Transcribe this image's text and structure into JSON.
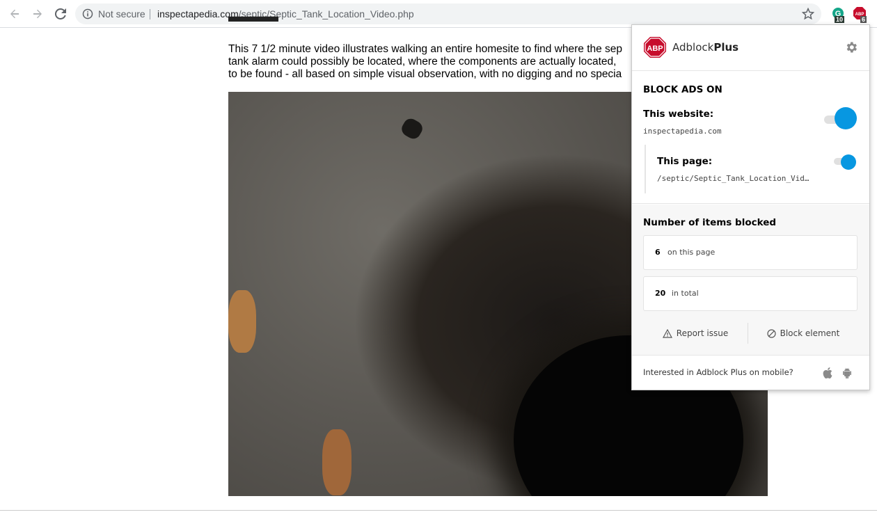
{
  "browser": {
    "security_label": "Not secure",
    "url_domain": "inspectapedia.com",
    "url_path": "/septic/Septic_Tank_Location_Video.php",
    "extensions": [
      {
        "name": "grammarly-extension-icon",
        "badge": "10"
      },
      {
        "name": "adblock-plus-extension-icon",
        "badge": "6"
      }
    ]
  },
  "page": {
    "intro_line1": "This 7 1/2 minute video illustrates walking an entire homesite to find where the sep",
    "intro_line2": "tank alarm could possibly be located, where the components are actually located,",
    "intro_line3": "to be found - all based on simple visual observation, with no digging and no specia"
  },
  "adblock": {
    "logo_text": "ABP",
    "brand_light": "Adblock",
    "brand_bold": "Plus",
    "block_ads_title": "BLOCK ADS ON",
    "website_label": "This website:",
    "website_value": "inspectapedia.com",
    "website_enabled": true,
    "page_label": "This page:",
    "page_value": "/septic/Septic_Tank_Location_Vid…",
    "page_enabled": true,
    "blocked_title": "Number of items blocked",
    "blocked_page_count": "6",
    "blocked_page_label": "on this page",
    "blocked_total_count": "20",
    "blocked_total_label": "in total",
    "report_issue_label": "Report issue",
    "block_element_label": "Block element",
    "mobile_prompt": "Interested in Adblock Plus on mobile?",
    "accent_color": "#0797e1",
    "logo_color": "#c70d2c"
  }
}
